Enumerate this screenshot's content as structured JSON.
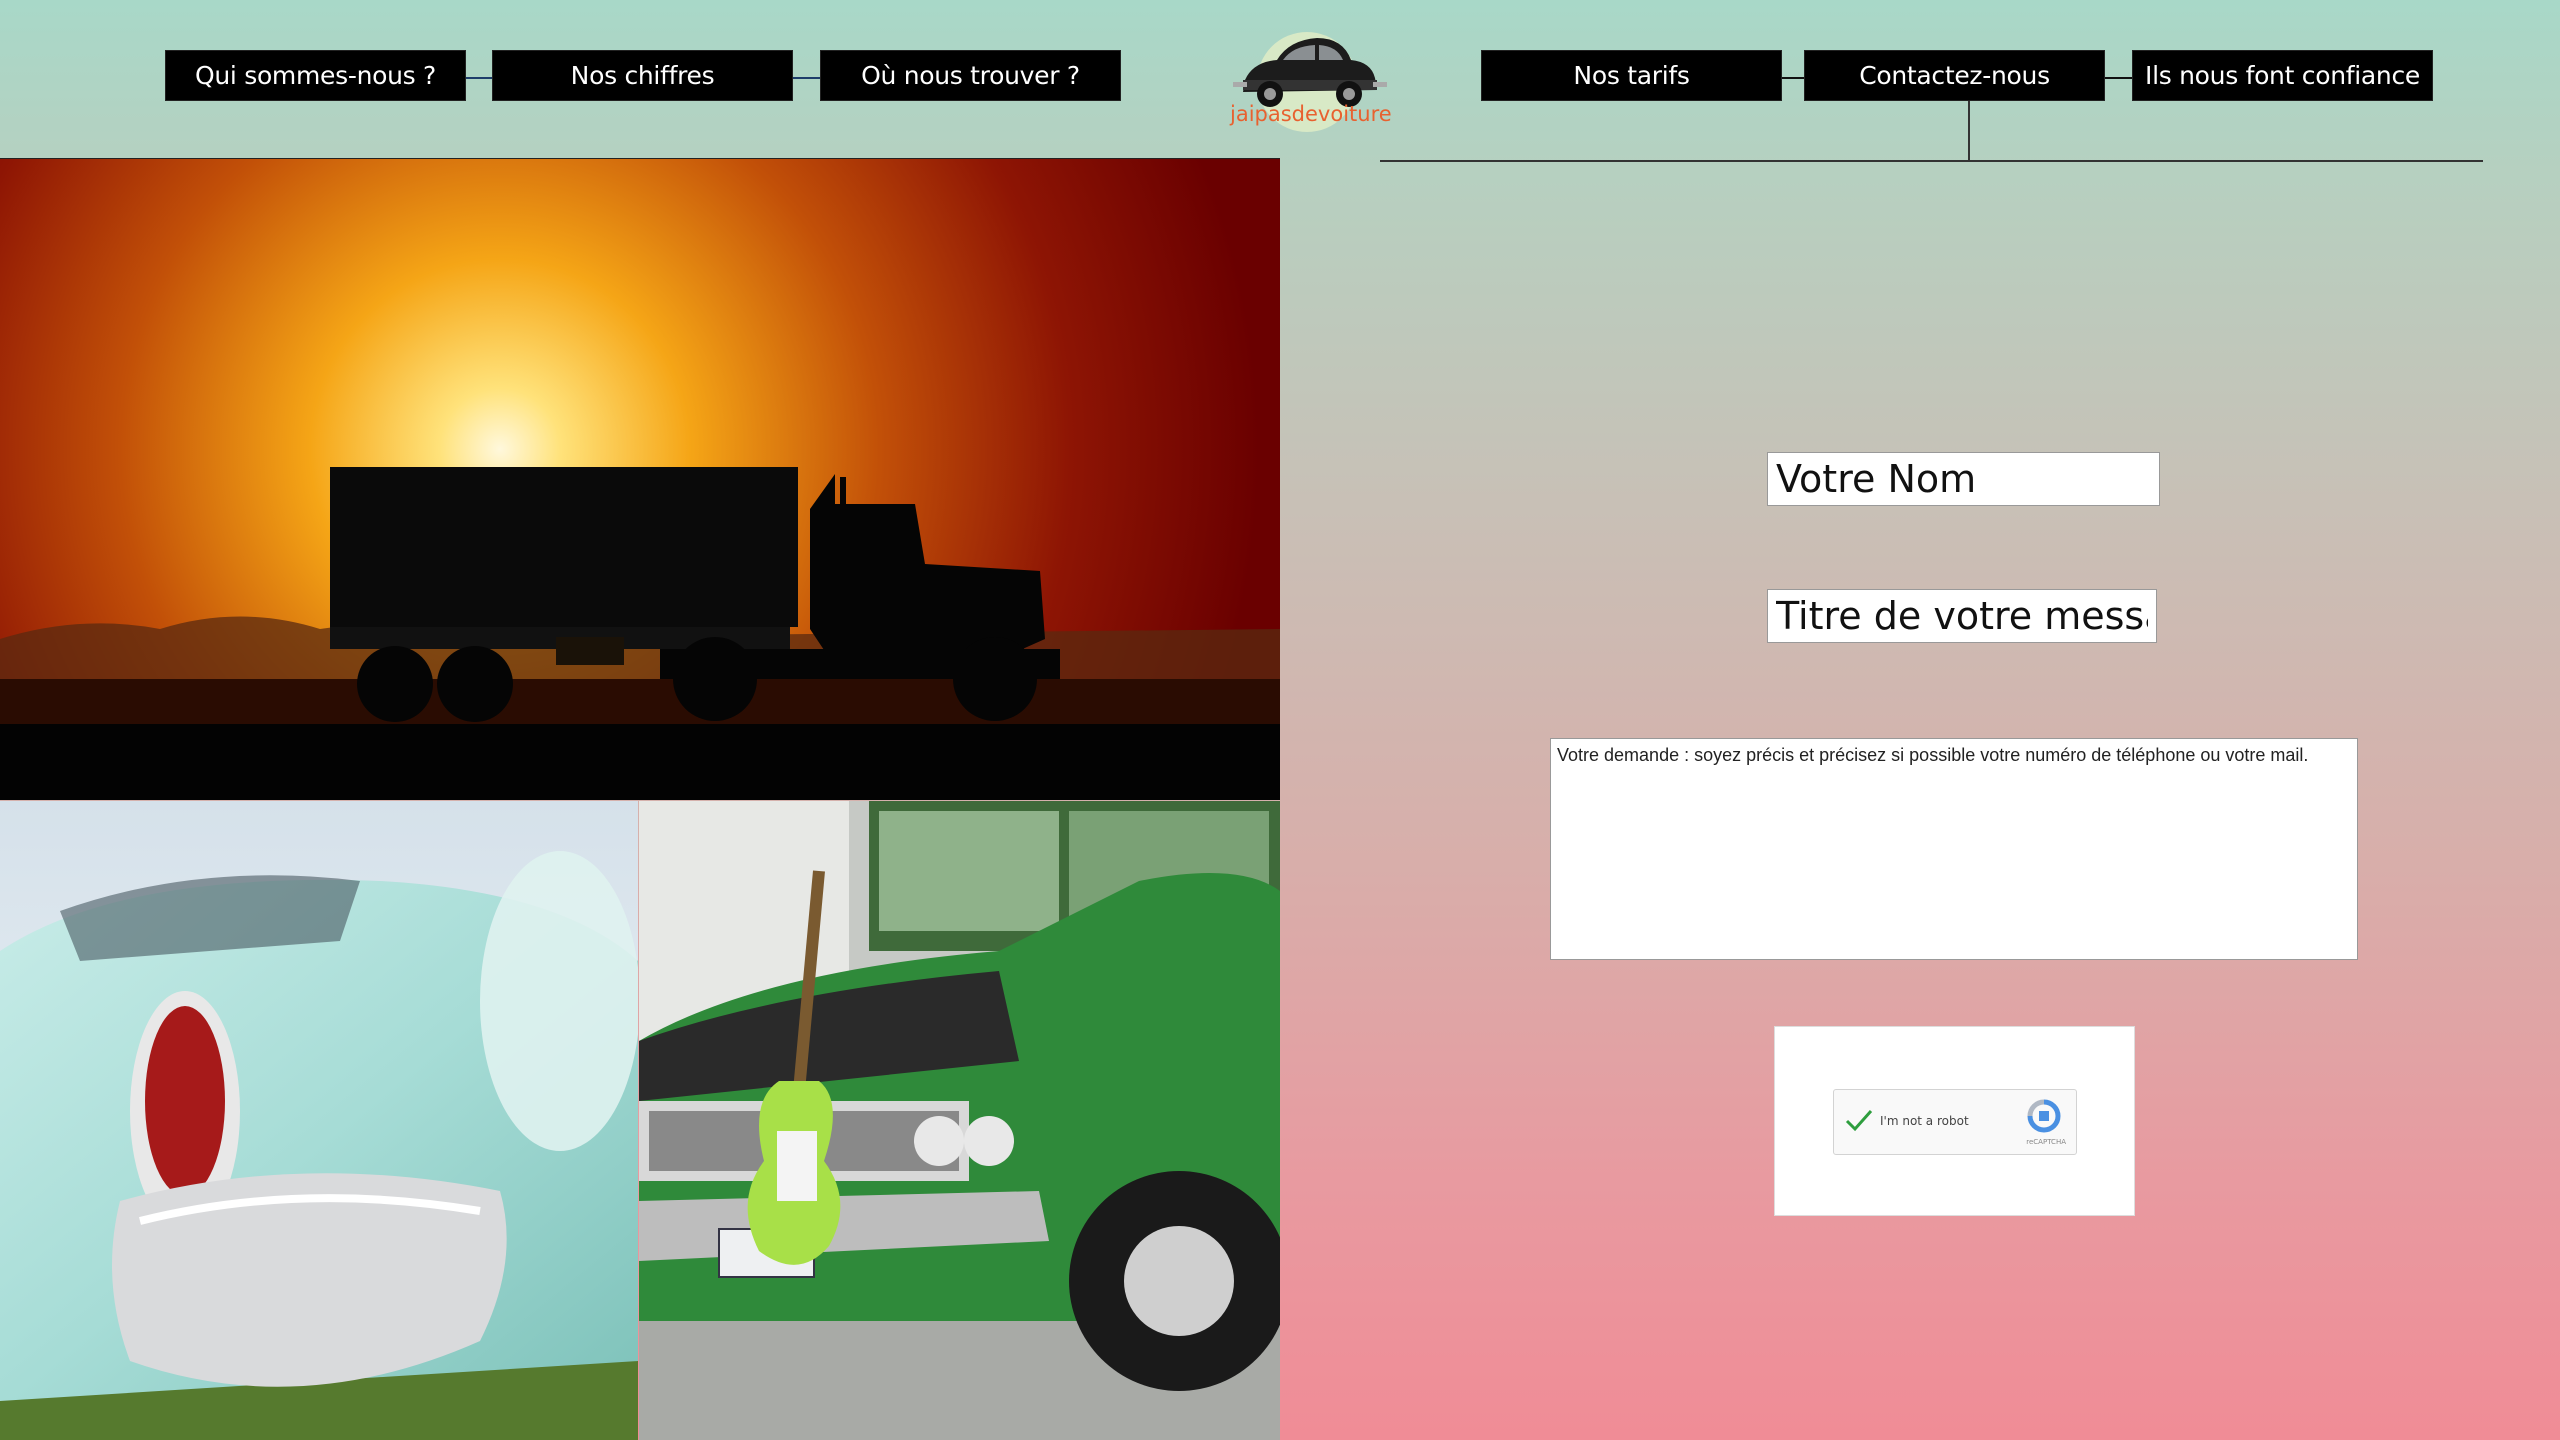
{
  "nav": {
    "left": [
      {
        "label": "Qui sommes-nous ?"
      },
      {
        "label": "Nos chiffres"
      },
      {
        "label": "Où nous trouver ?"
      }
    ],
    "right": [
      {
        "label": "Nos tarifs"
      },
      {
        "label": "Contactez-nous"
      },
      {
        "label": "Ils nous font confiance"
      }
    ]
  },
  "logo": {
    "text": "jaipasdevoiture",
    "color": "#e8612f"
  },
  "form": {
    "name_placeholder": "Votre Nom",
    "title_placeholder": "Titre de votre message",
    "request_placeholder": "Votre demande : soyez précis et précisez si possible votre numéro de téléphone ou votre mail.",
    "captcha_label": "I'm not a robot",
    "captcha_brand": "reCAPTCHA"
  },
  "colors": {
    "background_top": "#a8d8c8",
    "background_bottom": "#f08c96",
    "nav_button": "#000000"
  },
  "images": {
    "hero": "truck-silhouette-sunset",
    "bottom_left": "vintage-mint-car-taillight",
    "bottom_right": "green-muscle-car-with-guitar"
  }
}
